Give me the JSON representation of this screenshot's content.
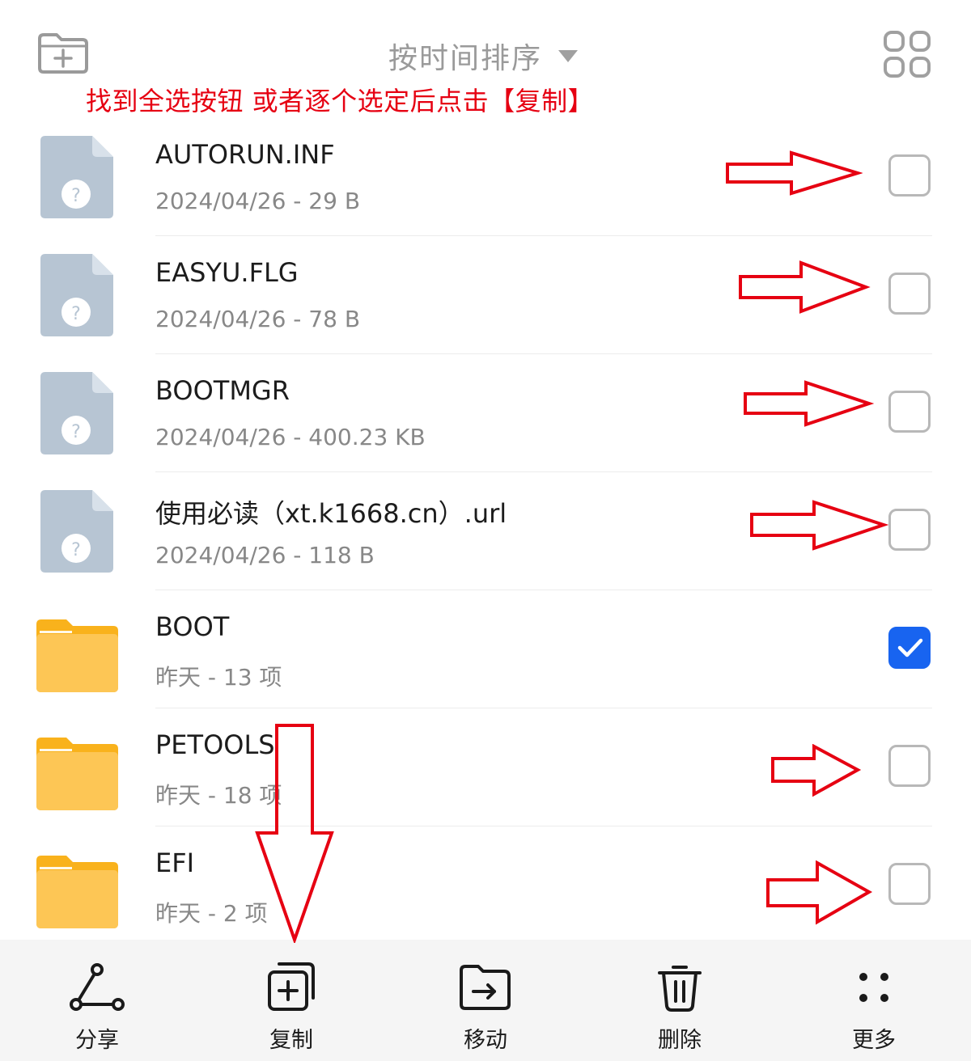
{
  "header": {
    "sort_label": "按时间排序",
    "new_folder_icon": "folder-plus-icon",
    "view_toggle_icon": "grid-view-icon"
  },
  "annotation": {
    "instruction_text": "找到全选按钮  或者逐个选定后点击【复制】",
    "color": "#e60012"
  },
  "files": [
    {
      "name": "AUTORUN.INF",
      "meta": "2024/04/26 - 29 B",
      "type": "unknown-file",
      "checked": false
    },
    {
      "name": "EASYU.FLG",
      "meta": "2024/04/26 - 78 B",
      "type": "unknown-file",
      "checked": false
    },
    {
      "name": "BOOTMGR",
      "meta": "2024/04/26 - 400.23 KB",
      "type": "unknown-file",
      "checked": false
    },
    {
      "name": "使用必读（xt.k1668.cn）.url",
      "meta": "2024/04/26 - 118 B",
      "type": "unknown-file",
      "checked": false
    },
    {
      "name": "BOOT",
      "meta": "昨天 - 13 项",
      "type": "folder",
      "checked": true
    },
    {
      "name": "PETOOLS",
      "meta": "昨天 - 18 项",
      "type": "folder",
      "checked": false
    },
    {
      "name": "EFI",
      "meta": "昨天 - 2 项",
      "type": "folder",
      "checked": false
    }
  ],
  "toolbar": {
    "share_label": "分享",
    "copy_label": "复制",
    "move_label": "移动",
    "delete_label": "删除",
    "more_label": "更多"
  },
  "colors": {
    "accent": "#1864f0",
    "folder": "#fdc655",
    "file_icon": "#b7c5d3",
    "annotation": "#e60012"
  }
}
